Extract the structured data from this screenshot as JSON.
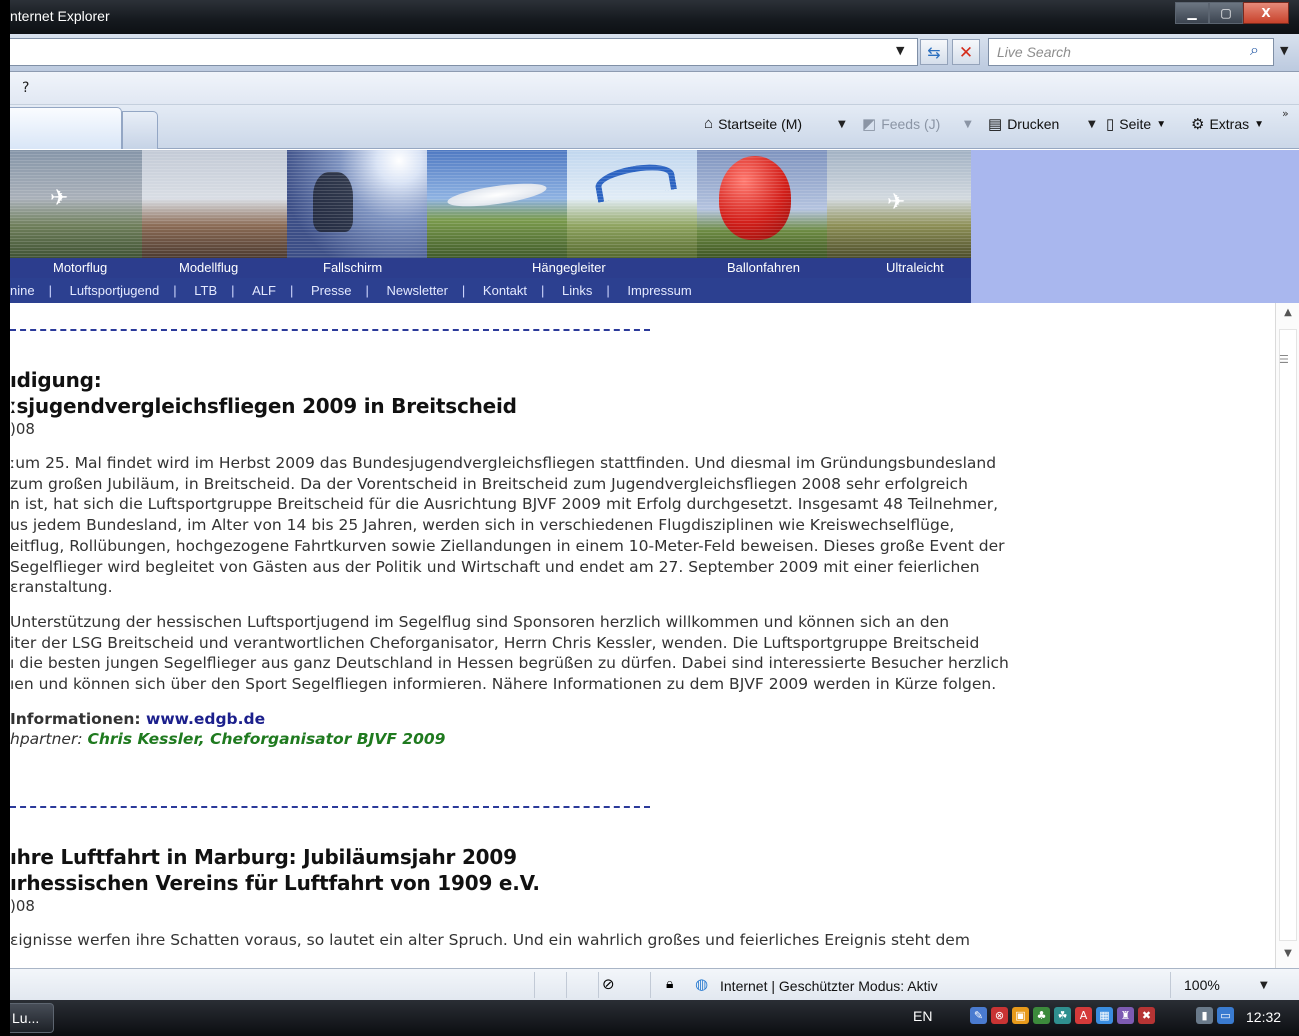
{
  "window": {
    "title": "nternet Explorer",
    "buttons": {
      "minimize": "▁",
      "maximize": "▢",
      "close": "X"
    }
  },
  "address_bar": {
    "url": "",
    "search_placeholder": "Live Search"
  },
  "menu_bar": {
    "items": [
      "?"
    ]
  },
  "command_bar": {
    "home": "Startseite (M)",
    "feeds": "Feeds (J)",
    "print": "Drucken",
    "page": "Seite",
    "tools": "Extras",
    "more": "»"
  },
  "banner": {
    "labels": [
      "Motorflug",
      "Modellflug",
      "Fallschirm",
      "Hängegleiter",
      "Ballonfahren",
      "Ultraleicht"
    ]
  },
  "nav": {
    "items": [
      "nine",
      "Luftsportjugend",
      "LTB",
      "ALF",
      "Presse",
      "Newsletter",
      "Kontakt",
      "Links",
      "Impressum"
    ]
  },
  "articles": [
    {
      "title_line1": "ıdigung:",
      "title_line2": "ːsjugendvergleichsfliegen 2009 in Breitscheid",
      "date": ")08",
      "paragraph1": [
        "ːum 25. Mal findet wird im Herbst 2009 das Bundesjugendvergleichsfliegen stattfinden. Und diesmal im Gründungsbundesland",
        " zum großen Jubiläum, in Breitscheid. Da der Vorentscheid in Breitscheid zum Jugendvergleichsfliegen 2008 sehr erfolgreich",
        "n ist, hat sich die Luftsportgruppe Breitscheid für die Ausrichtung BJVF 2009 mit Erfolg durchgesetzt. Insgesamt 48 Teilnehmer,",
        "us jedem Bundesland, im Alter von 14 bis 25 Jahren, werden sich in verschiedenen Flugdisziplinen wie Kreiswechselflüge,",
        "eitflug, Rollübungen, hochgezogene Fahrtkurven sowie Ziellandungen in einem 10-Meter-Feld beweisen. Dieses große Event der",
        "Segelflieger wird begleitet von Gästen aus der Politik und Wirtschaft und endet am 27. September 2009 mit einer feierlichen",
        "ɛranstaltung."
      ],
      "paragraph2": [
        "Unterstützung der hessischen Luftsportjugend im Segelflug sind Sponsoren herzlich willkommen und können sich an den",
        "iter der LSG Breitscheid und verantwortlichen Cheforganisator, Herrn Chris Kessler, wenden. Die Luftsportgruppe Breitscheid",
        "ı die besten jungen Segelflieger aus ganz Deutschland in Hessen begrüßen zu dürfen. Dabei sind interessierte Besucher herzlich",
        "ıen und können sich über den Sport Segelfliegen informieren. Nähere Informationen zu dem BJVF 2009 werden in Kürze folgen."
      ],
      "info_label": " Informationen: ",
      "info_link": "www.edgb.de",
      "contact_label": "hpartner: ",
      "contact_value": "Chris Kessler, Cheforganisator BJVF 2009"
    },
    {
      "title_line1": "ıhre Luftfahrt in Marburg: Jubiläumsjahr 2009",
      "title_line2": "ırhessischen Vereins für Luftfahrt von 1909 e.V.",
      "date": ")08",
      "paragraph1": [
        "ɛignisse werfen ihre Schatten voraus, so lautet ein alter Spruch. Und ein wahrlich großes und feierliches Ereignis steht dem"
      ]
    }
  ],
  "status_bar": {
    "zone": "Internet | Geschützter Modus: Aktiv",
    "zoom": "100%"
  },
  "taskbar": {
    "task_label": "Lu...",
    "language": "EN",
    "clock": "12:32"
  }
}
